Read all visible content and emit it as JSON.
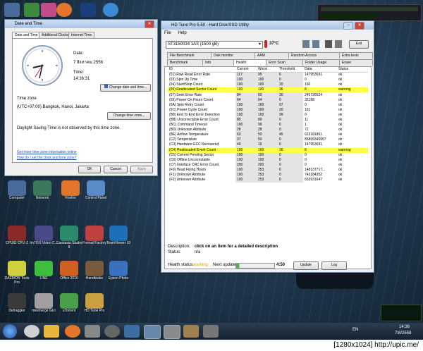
{
  "datetime_window": {
    "title": "Date and Time",
    "tabs": [
      "Date and Time",
      "Additional Clocks",
      "Internet Time"
    ],
    "date_label": "Date:",
    "date_value": "7 สิงหาคม 2558",
    "time_label": "Time:",
    "time_value": "14:36:31",
    "change_datetime_button": "Change date and time...",
    "timezone_label": "Time zone",
    "timezone_value": "(UTC+07:00) Bangkok, Hanoi, Jakarta",
    "change_timezone_button": "Change time zone...",
    "dst_text": "Daylight Saving Time is not observed by this time zone.",
    "link_more_tz": "Get more time zone information online",
    "link_how": "How do I set the clock and time zone?",
    "ok": "OK",
    "cancel": "Cancel",
    "apply": "Apply"
  },
  "hdtune": {
    "title": "HD Tune Pro 5.50 - Hard Disk/SSD Utility",
    "menu": [
      "File",
      "Help"
    ],
    "drive": "ST3150034 1AS (1500 gB)",
    "temperature": "37°C",
    "exit": "Exit",
    "tabs_row1": [
      "File Benchmark",
      "Disk monitor",
      "AAM",
      "Random Access",
      "Extra tests"
    ],
    "tabs_row2": [
      "Benchmark",
      "Info",
      "Health",
      "Error Scan",
      "Folder Usage",
      "Erase"
    ],
    "columns": [
      "ID",
      "Current",
      "Worst",
      "Threshold",
      "Data",
      "Status"
    ],
    "rows": [
      [
        "(01) Raw Read Error Rate",
        "117",
        "99",
        "6",
        "147953691",
        "ok"
      ],
      [
        "(03) Spin Up Time",
        "100",
        "100",
        "0",
        "0",
        "ok"
      ],
      [
        "(04) Start/Stop Count",
        "100",
        "100",
        "20",
        "160",
        "ok"
      ],
      [
        "(05) Reallocated Sector Count",
        "100",
        "100",
        "36",
        "8",
        "warning"
      ],
      [
        "(07) Seek Error Rate",
        "84",
        "60",
        "30",
        "245726524",
        "ok"
      ],
      [
        "(09) Power On Hours Count",
        "64",
        "64",
        "0",
        "32188",
        "ok"
      ],
      [
        "(0A) Spin Retry Count",
        "100",
        "100",
        "97",
        "0",
        "ok"
      ],
      [
        "(0C) Power Cycle Count",
        "100",
        "100",
        "20",
        "161",
        "ok"
      ],
      [
        "(B8) End To End Error Detection",
        "100",
        "100",
        "99",
        "0",
        "ok"
      ],
      [
        "(BB) Uncorrectable Error Count",
        "89",
        "89",
        "0",
        "11",
        "ok"
      ],
      [
        "(BC) Command Timeout",
        "100",
        "99",
        "0",
        "1",
        "ok"
      ],
      [
        "(BD) Unknown Attribute",
        "28",
        "28",
        "0",
        "72",
        "ok"
      ],
      [
        "(BE) Airflow Temperature",
        "63",
        "50",
        "45",
        "623181861",
        "ok"
      ],
      [
        "(C2) Temperature",
        "37",
        "50",
        "0",
        "85899345957",
        "ok"
      ],
      [
        "(C3) Hardware ECC Recovered",
        "40",
        "15",
        "0",
        "147953691",
        "ok"
      ],
      [
        "(C4) Reallocated Event Count",
        "100",
        "100",
        "36",
        "8",
        "warning"
      ],
      [
        "(C5) Current Pending Sector",
        "100",
        "100",
        "0",
        "0",
        "ok"
      ],
      [
        "(C6) Offline Uncorrectable",
        "100",
        "100",
        "0",
        "0",
        "ok"
      ],
      [
        "(C7) Interface CRC Error Count",
        "200",
        "200",
        "0",
        "0",
        "ok"
      ],
      [
        "(F0) Head Flying Hours",
        "100",
        "253",
        "0",
        "148137717...",
        "ok"
      ],
      [
        "(F1) Unknown Attribute",
        "100",
        "253",
        "0",
        "743184352",
        "ok"
      ],
      [
        "(F2) Unknown Attribute",
        "100",
        "253",
        "0",
        "653931647",
        "ok"
      ]
    ],
    "description_label": "Description:",
    "description_value": "click on an item for a detailed description",
    "status_label": "Status:",
    "status_value": "n/a",
    "health_status_label": "Health status:",
    "health_status_value": "warning",
    "next_update_label": "Next update:",
    "next_update_value": "4:50",
    "update_button": "Update",
    "log_button": "Log"
  },
  "desktop_icons": [
    {
      "label": "Computer"
    },
    {
      "label": "Network"
    },
    {
      "label": "Firefox"
    },
    {
      "label": "Control Panel"
    },
    {
      "label": "CPUID CPU-Z"
    },
    {
      "label": "ImTOO Video C..."
    },
    {
      "label": "Camtasia Studio 8"
    },
    {
      "label": "Format Factory"
    },
    {
      "label": "TeamViewer 10"
    },
    {
      "label": "DAEMON Tools Pro"
    },
    {
      "label": "LINE"
    },
    {
      "label": "Office 2010"
    },
    {
      "label": "Handbrake"
    },
    {
      "label": "Epson Photo"
    },
    {
      "label": "Defraggler"
    },
    {
      "label": "mkvmerge GUI"
    },
    {
      "label": "uTorrent"
    },
    {
      "label": "HD Tune Pro"
    }
  ],
  "taskbar": {
    "lang": "EN",
    "clock_time": "14:36",
    "clock_date": "7/8/2558"
  },
  "watermark": "[1280x1024] http://upic.me/",
  "colors": {
    "warning_highlight": "#ffff44",
    "health_warning_text": "#d4a800"
  }
}
